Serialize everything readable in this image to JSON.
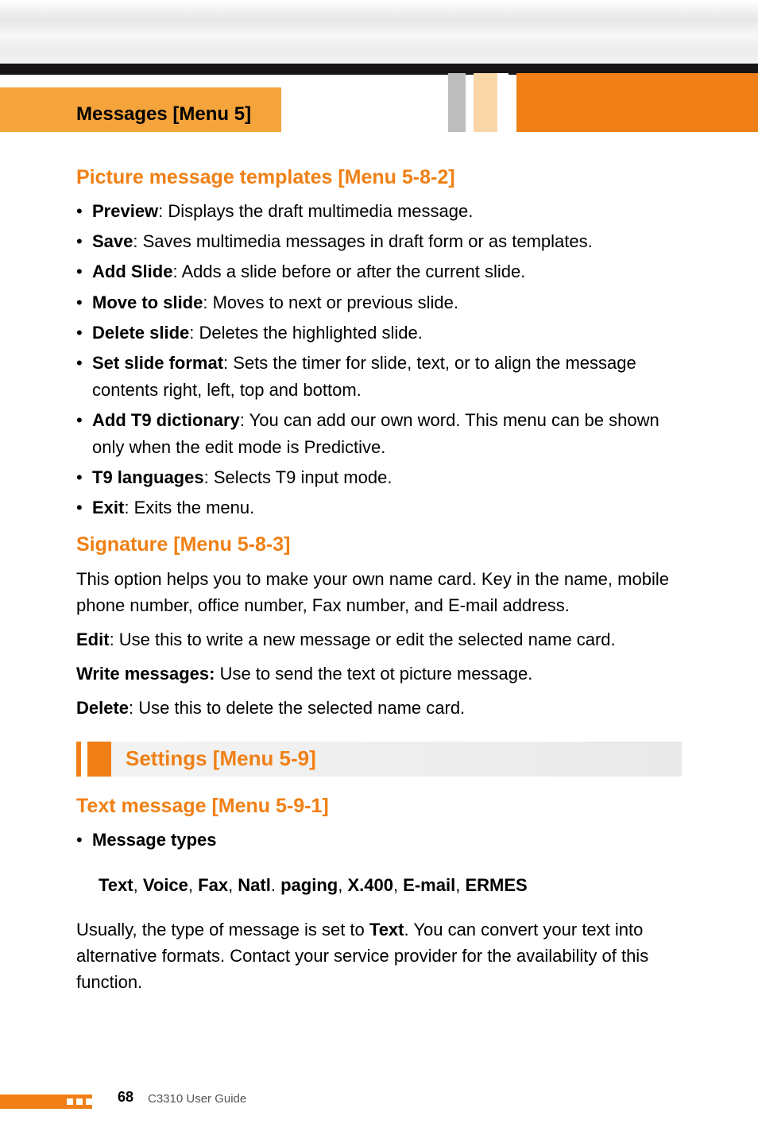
{
  "header": {
    "tab_label": "Messages [Menu 5]"
  },
  "section_picture": {
    "heading": "Picture message templates [Menu 5-8-2]",
    "items": [
      {
        "term": "Preview",
        "desc": ": Displays the draft multimedia message."
      },
      {
        "term": "Save",
        "desc": ": Saves multimedia messages in draft form or as templates."
      },
      {
        "term": "Add Slide",
        "desc": ": Adds a slide before or after the current slide."
      },
      {
        "term": "Move to slide",
        "desc": ": Moves to next or previous slide."
      },
      {
        "term": "Delete slide",
        "desc": ": Deletes the highlighted slide."
      },
      {
        "term": "Set slide format",
        "desc": ": Sets the timer for slide, text, or to align the message contents right, left, top and bottom."
      },
      {
        "term": "Add T9 dictionary",
        "desc": ": You can add our own word. This menu can be shown only when the edit mode is Predictive."
      },
      {
        "term": "T9 languages",
        "desc": ": Selects T9 input mode."
      },
      {
        "term": "Exit",
        "desc": ": Exits the menu."
      }
    ]
  },
  "section_signature": {
    "heading": "Signature [Menu 5-8-3]",
    "intro": "This option helps you to make your own name card. Key in the name, mobile phone number, office number, Fax number, and E-mail address.",
    "edit": {
      "term": "Edit",
      "desc": ": Use this to write a new message or edit the selected name card."
    },
    "write": {
      "term": "Write messages:",
      "desc": " Use to send the text ot picture message."
    },
    "delete": {
      "term": "Delete",
      "desc": ": Use this to delete the selected name card."
    }
  },
  "section_settings": {
    "heading": "Settings [Menu 5-9]"
  },
  "section_text_msg": {
    "heading": "Text message [Menu 5-9-1]",
    "types_label": "Message types",
    "types_list": [
      "Text",
      "Voice",
      "Fax",
      "Natl",
      "paging",
      "X.400",
      "E-mail",
      "ERMES"
    ],
    "types_joined": "Text, Voice, Fax, Natl. paging, X.400, E-mail, ERMES",
    "body_pre": "Usually, the type of message is set to ",
    "body_bold": "Text",
    "body_post": ". You can convert your text into alternative formats. Contact your service provider for the availability of this function."
  },
  "footer": {
    "page_number": "68",
    "guide_label": "C3310 User Guide"
  }
}
